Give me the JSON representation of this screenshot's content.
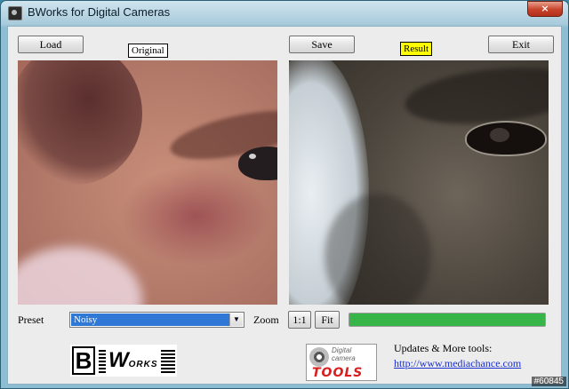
{
  "window": {
    "title": "BWorks for Digital Cameras",
    "close_label": "×"
  },
  "toolbar": {
    "load_label": "Load",
    "save_label": "Save",
    "exit_label": "Exit"
  },
  "images": {
    "original_label": "Original",
    "result_label": "Result"
  },
  "preset": {
    "label": "Preset",
    "value": "Noisy",
    "arrow": "▼"
  },
  "zoom": {
    "label": "Zoom",
    "one_to_one_label": "1:1",
    "fit_label": "Fit"
  },
  "progress": {
    "fraction": 1.0,
    "color": "#38b548"
  },
  "branding": {
    "bworks_letter": "B",
    "bworks_w": "W",
    "bworks_rest": "ORKS",
    "tools_digital": "Digital",
    "tools_camera": "camera",
    "tools_word": "TOOLS"
  },
  "updates": {
    "text": "Updates & More tools:",
    "link": "http://www.mediachance.com"
  },
  "watermark": "#60845",
  "colors": {
    "result_badge": "#ffff00",
    "link": "#1a2fd0",
    "selection": "#3078d6"
  }
}
